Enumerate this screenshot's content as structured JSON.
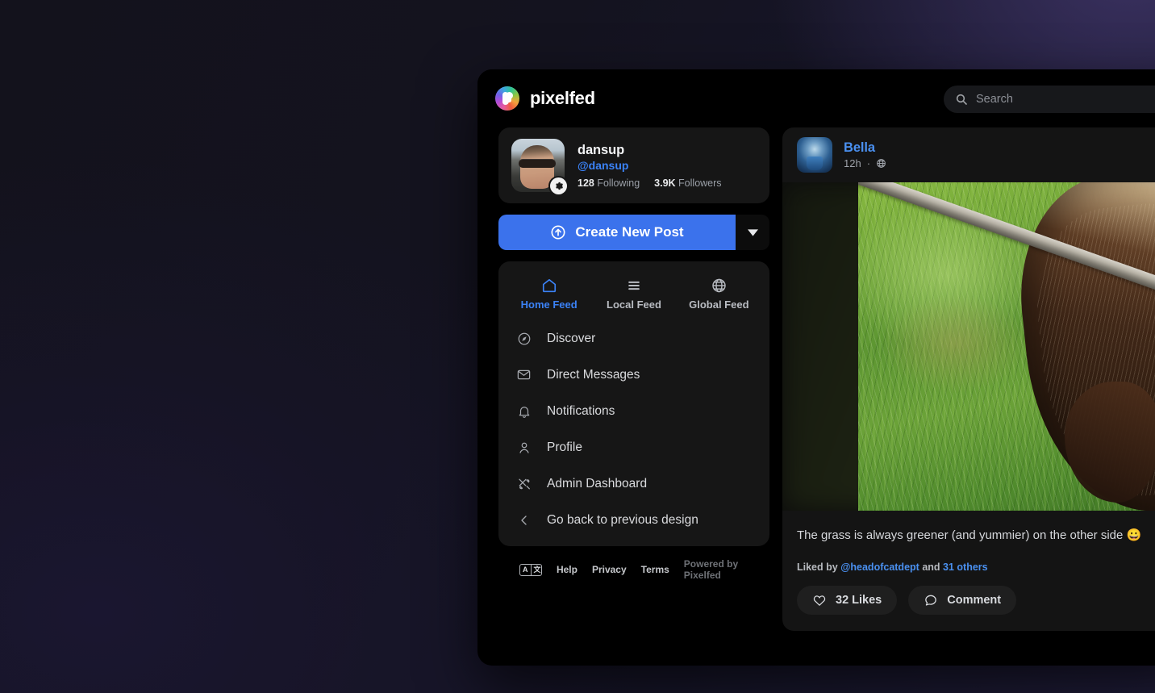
{
  "app": {
    "brand_name": "pixelfed"
  },
  "search": {
    "placeholder": "Search",
    "value": "",
    "icon": "search-icon"
  },
  "profile": {
    "username": "dansup",
    "handle": "@dansup",
    "following_count": "128",
    "following_label": "Following",
    "followers_count": "3.9K",
    "followers_label": "Followers",
    "settings_icon": "gear-icon",
    "avatar_alt": "person wearing sunglasses in a car"
  },
  "compose": {
    "create_label": "Create New Post",
    "create_icon": "upload-circle-icon",
    "caret_icon": "caret-down-icon",
    "accent_color": "#3b72ec"
  },
  "feed_tabs": [
    {
      "label": "Home Feed",
      "icon": "home-icon",
      "active": true
    },
    {
      "label": "Local Feed",
      "icon": "list-lines-icon",
      "active": false
    },
    {
      "label": "Global Feed",
      "icon": "globe-icon",
      "active": false
    }
  ],
  "nav_items": [
    {
      "label": "Discover",
      "icon": "compass-icon"
    },
    {
      "label": "Direct Messages",
      "icon": "envelope-icon"
    },
    {
      "label": "Notifications",
      "icon": "bell-icon"
    },
    {
      "label": "Profile",
      "icon": "user-icon"
    },
    {
      "label": "Admin Dashboard",
      "icon": "tools-icon"
    },
    {
      "label": "Go back to previous design",
      "icon": "chevron-left-icon"
    }
  ],
  "footer": {
    "lang_icon": "translate-icon",
    "lang_left": "A",
    "lang_right": "文",
    "links": [
      {
        "label": "Help"
      },
      {
        "label": "Privacy"
      },
      {
        "label": "Terms"
      }
    ],
    "powered_by": "Powered by Pixelfed"
  },
  "post": {
    "author": "Bella",
    "timestamp": "12h",
    "separator": "·",
    "visibility_icon": "globe-icon",
    "avatar_alt": "blue-toned photo of flowers in a vase",
    "media_alt": "a pony grazing on green grass behind a wire fence",
    "caption": "The grass is always greener (and yummier) on the other side 😀",
    "liked_by_prefix": "Liked by",
    "liked_by_user": "@headofcatdept",
    "liked_by_and": "and",
    "liked_by_others": "31 others",
    "like_label": "32 Likes",
    "like_icon": "heart-icon",
    "comment_label": "Comment",
    "comment_icon": "speech-bubble-icon"
  },
  "theme": {
    "accent_blue": "#3b82f6",
    "link_blue": "#4a90f0",
    "window_bg": "#000000",
    "card_bg": "#161616",
    "desktop_bg": "#14141f"
  }
}
